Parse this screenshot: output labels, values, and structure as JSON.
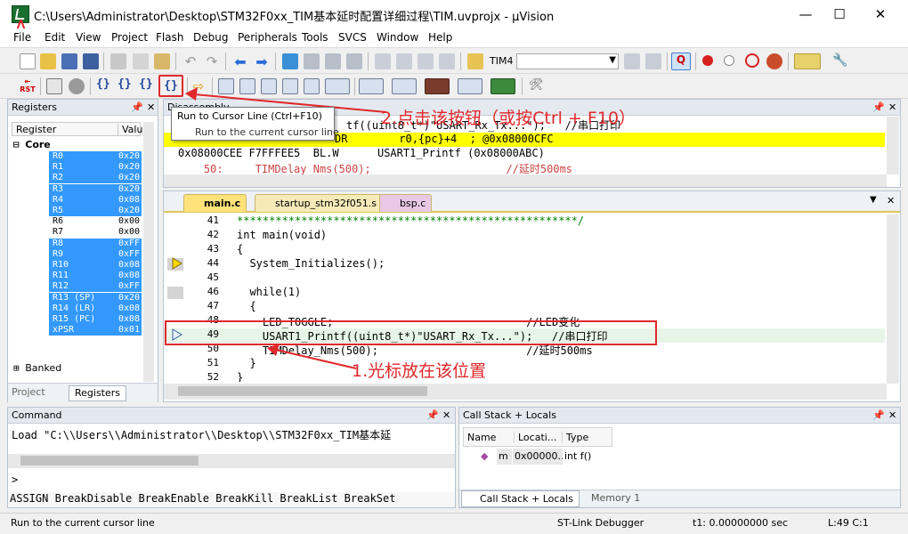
{
  "window": {
    "title": "C:\\Users\\Administrator\\Desktop\\STM32F0xx_TIM基本延时配置详细过程\\TIM.uvprojx - µVision"
  },
  "menu": [
    "File",
    "Edit",
    "View",
    "Project",
    "Flash",
    "Debug",
    "Peripherals",
    "Tools",
    "SVCS",
    "Window",
    "Help"
  ],
  "toolbar": {
    "target": "TIM4"
  },
  "tooltip": {
    "title": "Run to Cursor Line (Ctrl+F10)",
    "desc": "Run to the current cursor line"
  },
  "annotations": {
    "a": "A",
    "step2": "2.点击该按钮（或按Ctrl + F10）",
    "step1": "1.光标放在该位置"
  },
  "registers": {
    "title": "Registers",
    "col_register": "Register",
    "col_value": "Valu",
    "group_core": "Core",
    "rows": [
      {
        "name": "R0",
        "value": "0x20",
        "sel": true
      },
      {
        "name": "R1",
        "value": "0x20",
        "sel": true
      },
      {
        "name": "R2",
        "value": "0x20",
        "sel": true
      },
      {
        "name": "R3",
        "value": "0x20",
        "sel": true
      },
      {
        "name": "R4",
        "value": "0x08",
        "sel": true
      },
      {
        "name": "R5",
        "value": "0x20",
        "sel": true
      },
      {
        "name": "R6",
        "value": "0x00",
        "sel": false
      },
      {
        "name": "R7",
        "value": "0x00",
        "sel": false
      },
      {
        "name": "R8",
        "value": "0xFF",
        "sel": true
      },
      {
        "name": "R9",
        "value": "0xFF",
        "sel": true
      },
      {
        "name": "R10",
        "value": "0x08",
        "sel": true
      },
      {
        "name": "R11",
        "value": "0x08",
        "sel": true
      },
      {
        "name": "R12",
        "value": "0xFF",
        "sel": true
      },
      {
        "name": "R13 (SP)",
        "value": "0x20",
        "sel": true
      },
      {
        "name": "R14 (LR)",
        "value": "0x08",
        "sel": true
      },
      {
        "name": "R15 (PC)",
        "value": "0x08",
        "sel": true
      },
      {
        "name": "xPSR",
        "value": "0x01",
        "sel": true
      }
    ],
    "group_banked": "Banked",
    "tab_project": "Project",
    "tab_registers": "Registers"
  },
  "disassembly": {
    "title": "Disassembly",
    "lines": [
      {
        "text": "tf((uint8_t*)\"USART_Rx_Tx...\");   //串口打印",
        "hl": false
      },
      {
        "text": "DR        r0,{pc}+4  ; @0x08000CFC",
        "hl": true
      },
      {
        "text": "0x08000CEE F7FFFEE5  BL.W      USART1_Printf (0x08000ABC)",
        "hl": false
      },
      {
        "text": "    50:     TIMDelay_Nms(500);                     //延时500ms",
        "hl": false
      }
    ]
  },
  "editor": {
    "tabs": [
      "main.c",
      "startup_stm32f051.s",
      "bsp.c"
    ],
    "lines": [
      {
        "no": "41",
        "text": "*****************************************************/",
        "cls": "cm"
      },
      {
        "no": "42",
        "text": "int main(void)",
        "cls": ""
      },
      {
        "no": "43",
        "text": "{",
        "cls": ""
      },
      {
        "no": "44",
        "text": "  System_Initializes();",
        "cls": ""
      },
      {
        "no": "45",
        "text": "",
        "cls": ""
      },
      {
        "no": "46",
        "text": "  while(1)",
        "cls": ""
      },
      {
        "no": "47",
        "text": "  {",
        "cls": ""
      },
      {
        "no": "48",
        "text": "    LED_TOGGLE;                              //LED变化",
        "cls": ""
      },
      {
        "no": "49",
        "text": "    USART1_Printf((uint8_t*)\"USART_Rx_Tx...\");   //串口打印",
        "cls": ""
      },
      {
        "no": "50",
        "text": "    TIMDelay_Nms(500);                       //延时500ms",
        "cls": ""
      },
      {
        "no": "51",
        "text": "  }",
        "cls": ""
      },
      {
        "no": "52",
        "text": "}",
        "cls": ""
      }
    ]
  },
  "command": {
    "title": "Command",
    "output": "Load \"C:\\\\Users\\\\Administrator\\\\Desktop\\\\STM32F0xx_TIM基本延",
    "prompt": ">",
    "hint": "ASSIGN BreakDisable BreakEnable BreakKill BreakList BreakSet"
  },
  "callstack": {
    "title": "Call Stack + Locals",
    "col_name": "Name",
    "col_location": "Locati...",
    "col_type": "Type",
    "row": {
      "name": "m",
      "location": "0x00000...",
      "type": "int f()"
    },
    "tab_callstack": "Call Stack + Locals",
    "tab_memory": "Memory 1"
  },
  "status": {
    "message": "Run to the current cursor line",
    "debugger": "ST-Link Debugger",
    "time": "t1: 0.00000000 sec",
    "position": "L:49 C:1"
  }
}
